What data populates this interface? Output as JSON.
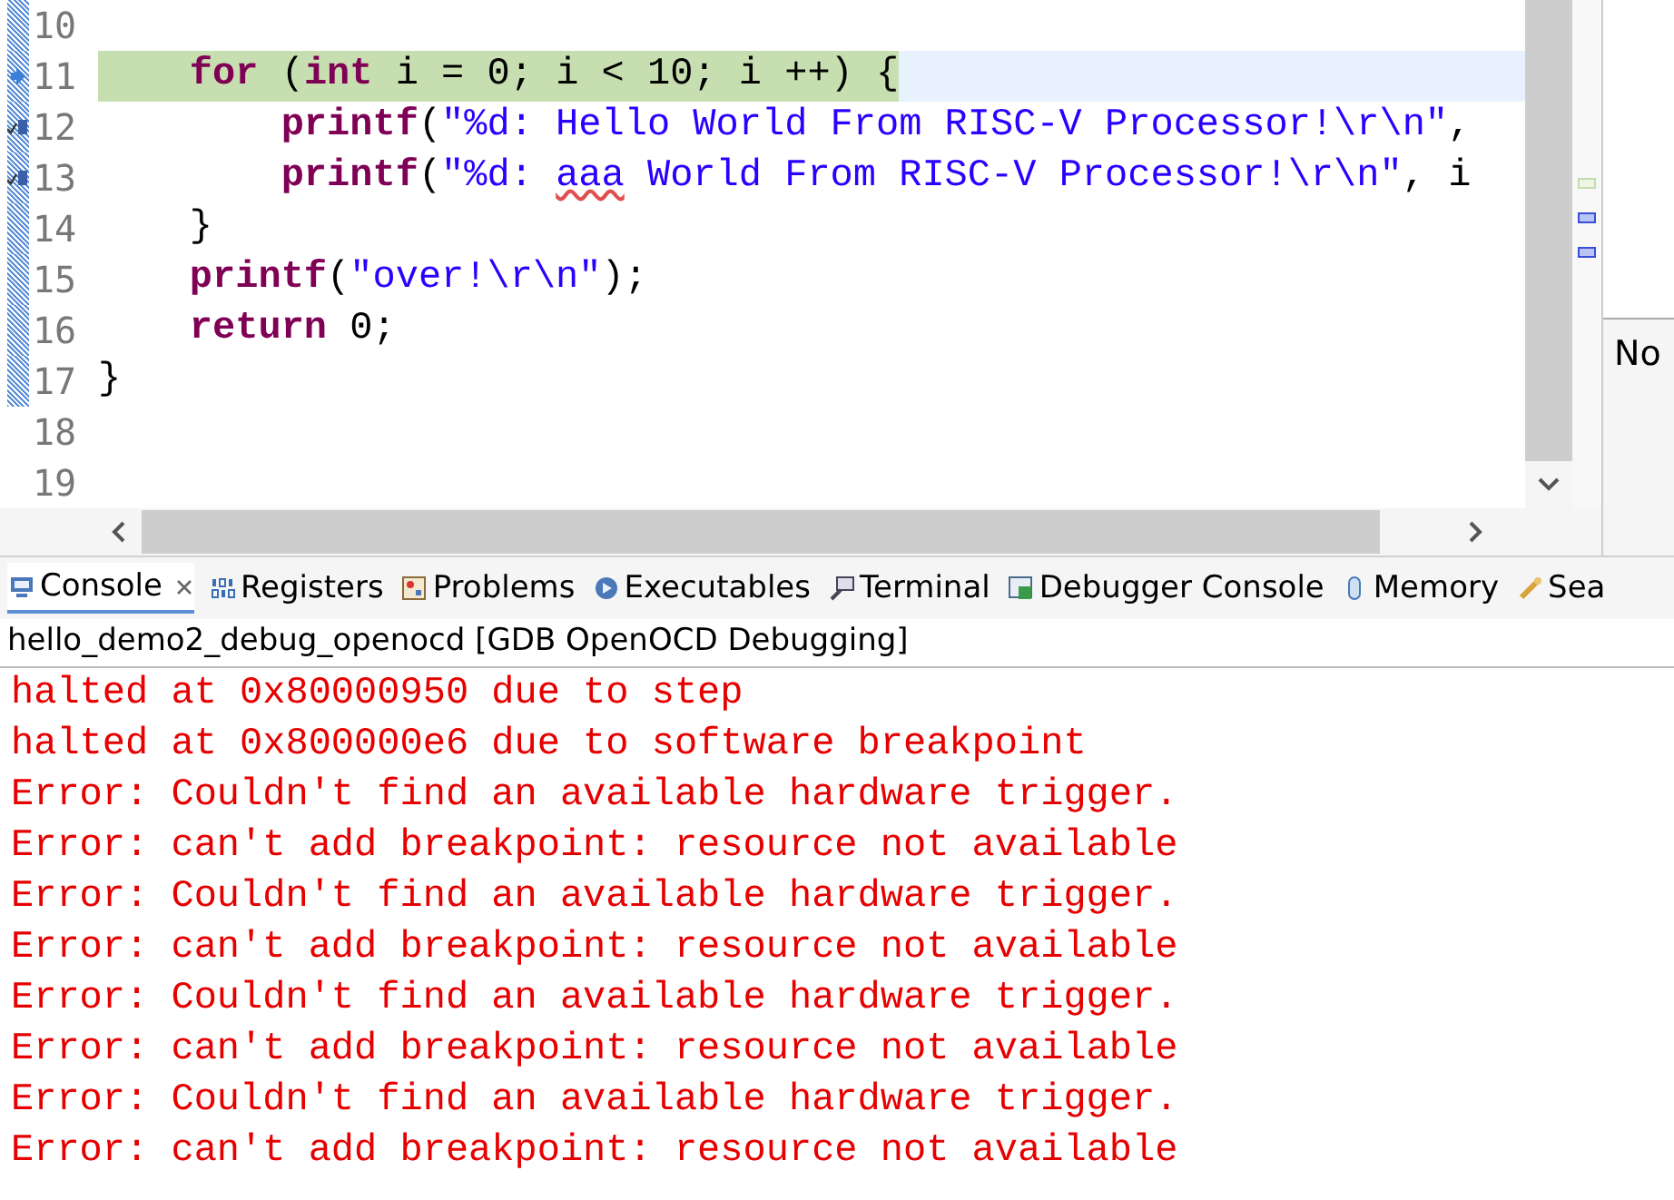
{
  "editor": {
    "lines": [
      {
        "number": "10",
        "current": false,
        "in_range": true,
        "breakpoint": false,
        "instruction_pointer": false
      },
      {
        "number": "11",
        "current": true,
        "in_range": true,
        "breakpoint": false,
        "instruction_pointer": true,
        "tokens": [
          {
            "kind": "keyword",
            "text": "    for"
          },
          {
            "kind": "plain",
            "text": " ("
          },
          {
            "kind": "keyword",
            "text": "int"
          },
          {
            "kind": "plain",
            "text": " i = 0; i < 10; i ++) {"
          }
        ]
      },
      {
        "number": "12",
        "current": false,
        "in_range": true,
        "breakpoint": true,
        "instruction_pointer": false,
        "tokens": [
          {
            "kind": "keyword",
            "text": "        printf"
          },
          {
            "kind": "plain",
            "text": "("
          },
          {
            "kind": "string",
            "text": "\"%d: Hello World From RISC-V Processor!\\r\\n\""
          },
          {
            "kind": "plain",
            "text": ","
          }
        ]
      },
      {
        "number": "13",
        "current": false,
        "in_range": true,
        "breakpoint": true,
        "instruction_pointer": false,
        "tokens": [
          {
            "kind": "keyword",
            "text": "        printf"
          },
          {
            "kind": "plain",
            "text": "("
          },
          {
            "kind": "string",
            "text": "\"%d: "
          },
          {
            "kind": "misspelled",
            "text": "aaa"
          },
          {
            "kind": "string",
            "text": " World From RISC-V Processor!\\r\\n\""
          },
          {
            "kind": "plain",
            "text": ", i"
          }
        ]
      },
      {
        "number": "14",
        "current": false,
        "in_range": true,
        "breakpoint": false,
        "instruction_pointer": false,
        "tokens": [
          {
            "kind": "plain",
            "text": "    }"
          }
        ]
      },
      {
        "number": "15",
        "current": false,
        "in_range": true,
        "breakpoint": false,
        "instruction_pointer": false,
        "tokens": [
          {
            "kind": "keyword",
            "text": "    printf"
          },
          {
            "kind": "plain",
            "text": "("
          },
          {
            "kind": "string",
            "text": "\"over!\\r\\n\""
          },
          {
            "kind": "plain",
            "text": ");"
          }
        ]
      },
      {
        "number": "16",
        "current": false,
        "in_range": true,
        "breakpoint": false,
        "instruction_pointer": false,
        "tokens": [
          {
            "kind": "keyword",
            "text": "    return"
          },
          {
            "kind": "plain",
            "text": " 0;"
          }
        ]
      },
      {
        "number": "17",
        "current": false,
        "in_range": true,
        "breakpoint": false,
        "instruction_pointer": false,
        "tokens": [
          {
            "kind": "plain",
            "text": "}"
          }
        ]
      },
      {
        "number": "18",
        "current": false,
        "in_range": false,
        "breakpoint": false,
        "instruction_pointer": false
      },
      {
        "number": "19",
        "current": false,
        "in_range": false,
        "breakpoint": false,
        "instruction_pointer": false
      }
    ]
  },
  "side_panel": {
    "text": "No"
  },
  "tabs": [
    {
      "label": "Console",
      "selected": true
    },
    {
      "label": "Registers",
      "selected": false
    },
    {
      "label": "Problems",
      "selected": false
    },
    {
      "label": "Executables",
      "selected": false
    },
    {
      "label": "Terminal",
      "selected": false
    },
    {
      "label": "Debugger Console",
      "selected": false
    },
    {
      "label": "Memory",
      "selected": false
    },
    {
      "label": "Sea",
      "selected": false
    }
  ],
  "console": {
    "title": "hello_demo2_debug_openocd [GDB OpenOCD Debugging]",
    "lines": [
      "halted at 0x80000950 due to step",
      "halted at 0x800000e6 due to software breakpoint",
      "Error: Couldn't find an available hardware trigger.",
      "Error: can't add breakpoint: resource not available",
      "Error: Couldn't find an available hardware trigger.",
      "Error: can't add breakpoint: resource not available",
      "Error: Couldn't find an available hardware trigger.",
      "Error: can't add breakpoint: resource not available",
      "Error: Couldn't find an available hardware trigger.",
      "Error: can't add breakpoint: resource not available"
    ]
  }
}
